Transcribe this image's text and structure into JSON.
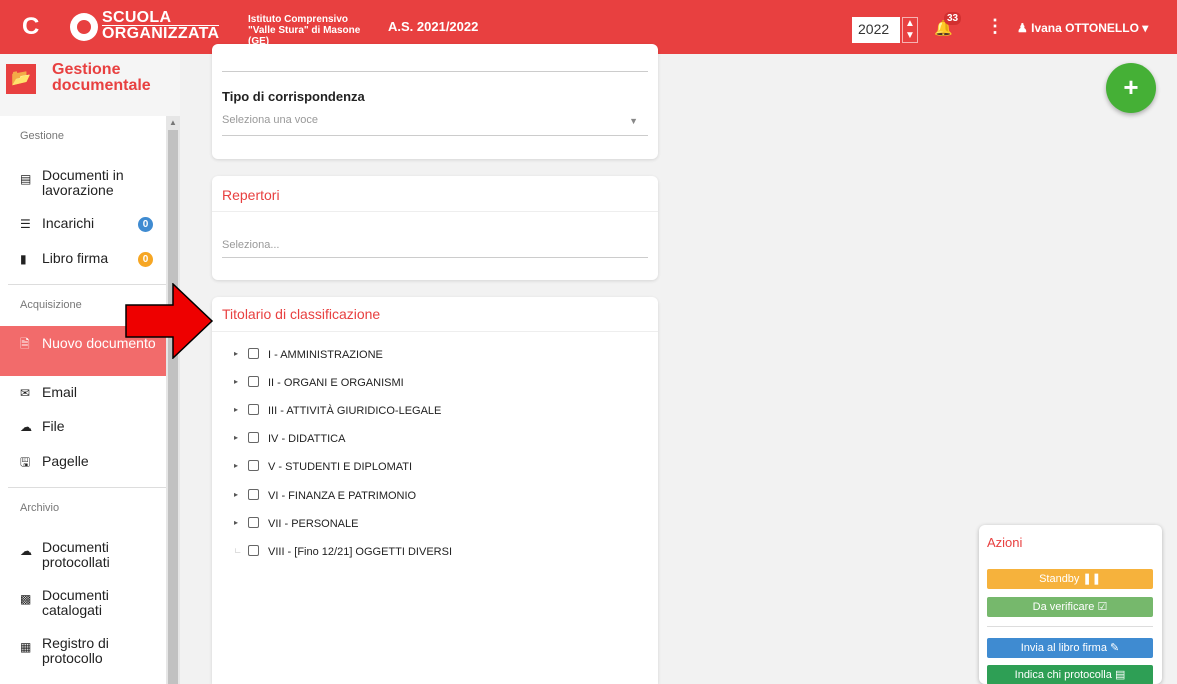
{
  "topbar": {
    "reload_icon": "C",
    "brand_line1": "SCUOLA",
    "brand_line2": "ORGANIZZATA",
    "school": "Istituto Comprensivo \"Valle Stura\" di Masone (GE)",
    "school_year": "A.S. 2021/2022",
    "year_value": "2022",
    "notifications": "33",
    "user": "Ivana OTTONELLO"
  },
  "sidebar": {
    "module_title": "Gestione documentale",
    "sections": {
      "gestione": "Gestione",
      "acquisizione": "Acquisizione",
      "archivio": "Archivio"
    },
    "items": {
      "documenti_lavorazione": "Documenti in lavorazione",
      "incarichi": "Incarichi",
      "incarichi_count": "0",
      "libro_firma": "Libro firma",
      "libro_firma_count": "0",
      "nuovo_documento": "Nuovo documento",
      "email": "Email",
      "file": "File",
      "pagelle": "Pagelle",
      "documenti_protocollati": "Documenti protocollati",
      "documenti_catalogati": "Documenti catalogati",
      "registro_protocollo": "Registro di protocollo"
    }
  },
  "main": {
    "tipo_label": "Tipo di corrispondenza",
    "tipo_placeholder": "Seleziona una voce",
    "repertori_title": "Repertori",
    "repertori_placeholder": "Seleziona...",
    "titolario_title": "Titolario di classificazione",
    "titolario_items": [
      "I - AMMINISTRAZIONE",
      "II - ORGANI E ORGANISMI",
      "III - ATTIVITÀ GIURIDICO-LEGALE",
      "IV - DIDATTICA",
      "V - STUDENTI E DIPLOMATI",
      "VI - FINANZA E PATRIMONIO",
      "VII - PERSONALE",
      "VIII - [Fino 12/21] OGGETTI DIVERSI"
    ]
  },
  "azioni": {
    "title": "Azioni",
    "standby": "Standby",
    "da_verificare": "Da verificare",
    "invia_libro_firma": "Invia al libro firma",
    "indica_chi_protocolla": "Indica chi protocolla"
  },
  "colors": {
    "brand_red": "#e84040",
    "active_item": "#f26b6b",
    "fab_green": "#45b036",
    "standby": "#f6b23c",
    "da_verificare": "#76b86c",
    "invia": "#3f8bd1",
    "indica": "#2e9f55"
  },
  "icons": {
    "module": "folder-open-icon",
    "fab": "plus-icon",
    "arrow": "red-arrow-annotation"
  }
}
